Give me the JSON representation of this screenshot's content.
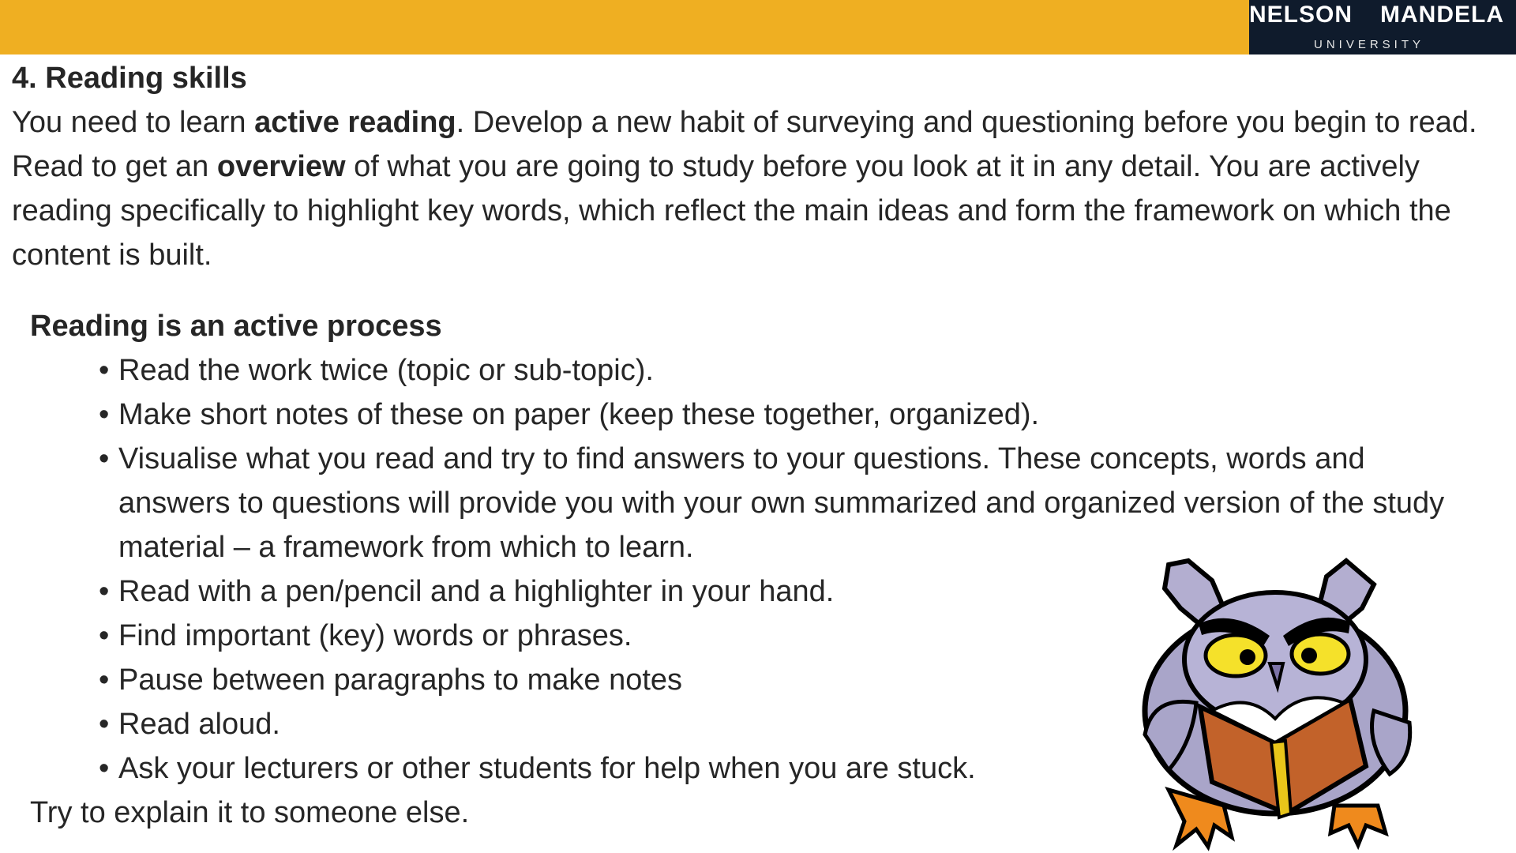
{
  "header": {
    "logo": {
      "word1": "NELSON",
      "word2": "MANDELA",
      "subtitle": "UNIVERSITY"
    },
    "bar_color": "#efaf22",
    "logo_background": "#0f1b2c"
  },
  "heading": "4. Reading skills",
  "intro": {
    "p1": "You need to learn ",
    "b1": "active reading",
    "p2": ". Develop a new habit of surveying and questioning before you begin to read. Read to get an ",
    "b2": "overview",
    "p3": " of what you are going to study before you look at it in any detail.  You are actively reading specifically to highlight key words, which reflect the main ideas and form the framework on which the content is built."
  },
  "process": {
    "title": "Reading is an active process",
    "bullets": [
      "Read the work twice (topic or sub-topic).",
      "Make short notes of these on paper (keep these together, organized).",
      "Visualise what you read and try to find answers to your questions.  These concepts, words and answers to questions will provide you with your own summarized and organized version of the study material – a framework from which to learn.",
      "Read with a pen/pencil and a highlighter in your hand.",
      "Find important (key) words or phrases.",
      "Pause between paragraphs to make notes",
      "Read aloud.",
      "Ask your lecturers or other students for help when you are stuck."
    ],
    "closing": "Try to explain it to someone else."
  },
  "illustration": {
    "icon": "owl-reading-book-icon"
  }
}
